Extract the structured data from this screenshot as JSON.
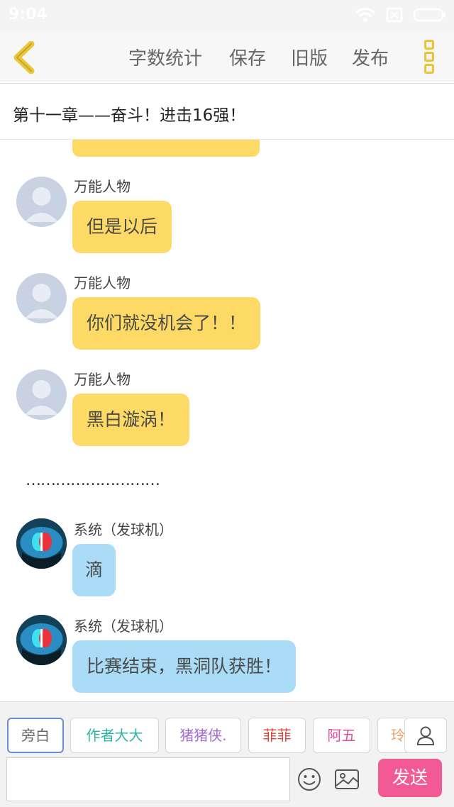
{
  "status_bar": {
    "time": "9:04"
  },
  "top_bar": {
    "actions": [
      "字数统计",
      "保存",
      "旧版",
      "发布"
    ],
    "accent_color": "#e9c536"
  },
  "chapter": {
    "title": "第十一章——奋斗！进击16强！"
  },
  "messages": [
    {
      "sender": "万能人物",
      "text": "但是以后",
      "type": "default"
    },
    {
      "sender": "万能人物",
      "text": "你们就没机会了！！",
      "type": "default"
    },
    {
      "sender": "万能人物",
      "text": "黑白漩涡！",
      "type": "default"
    },
    {
      "sender": "系统（发球机）",
      "text": "滴",
      "type": "system"
    },
    {
      "sender": "系统（发球机）",
      "text": "比赛结束，黑洞队获胜！",
      "type": "system"
    }
  ],
  "separator": "………………………",
  "roles": [
    {
      "label": "旁白",
      "color": "#666666"
    },
    {
      "label": "作者大大",
      "color": "#2bb5a6"
    },
    {
      "label": "猪猪侠.",
      "color": "#a26bd1"
    },
    {
      "label": "菲菲",
      "color": "#e0473c"
    },
    {
      "label": "阿五",
      "color": "#e34a9a"
    },
    {
      "label": "玲",
      "color": "#f0a06a"
    }
  ],
  "input": {
    "value": "",
    "placeholder": ""
  },
  "send_label": "发送",
  "colors": {
    "yellow_bubble": "#fdd965",
    "blue_bubble": "#aadcf7",
    "send": "#f25a93"
  }
}
